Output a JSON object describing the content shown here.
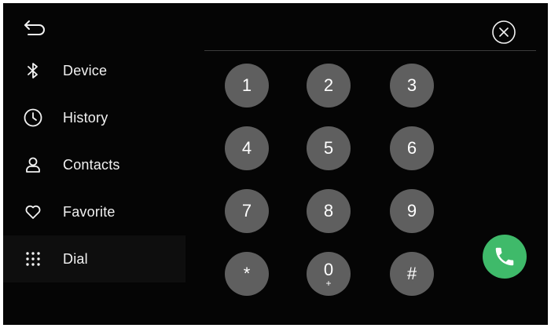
{
  "header": {
    "back_icon": "back-arrow-icon",
    "close_icon": "close-circle-icon"
  },
  "sidebar": {
    "items": [
      {
        "label": "Device",
        "icon": "bluetooth-icon"
      },
      {
        "label": "History",
        "icon": "clock-icon"
      },
      {
        "label": "Contacts",
        "icon": "person-icon"
      },
      {
        "label": "Favorite",
        "icon": "heart-icon"
      },
      {
        "label": "Dial",
        "icon": "dialpad-icon",
        "active": true
      }
    ]
  },
  "dialpad": {
    "keys": [
      {
        "main": "1"
      },
      {
        "main": "2"
      },
      {
        "main": "3"
      },
      {
        "main": "4"
      },
      {
        "main": "5"
      },
      {
        "main": "6"
      },
      {
        "main": "7"
      },
      {
        "main": "8"
      },
      {
        "main": "9"
      },
      {
        "main": "*"
      },
      {
        "main": "0",
        "sub": "+"
      },
      {
        "main": "#"
      }
    ],
    "call_icon": "phone-icon"
  },
  "colors": {
    "background": "#050505",
    "key": "#5f5f5f",
    "call": "#3fba6a",
    "text": "#f2f2f2"
  }
}
